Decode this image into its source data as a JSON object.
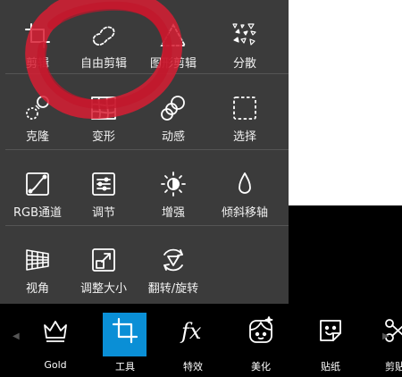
{
  "colors": {
    "panel_bg": "#3b3b3b",
    "accent": "#0a8fd6",
    "scribble": "#d81e34",
    "icon": "#ffffff"
  },
  "tools": [
    [
      {
        "label": "剪辑",
        "icon": "crop-icon",
        "label_color": "#ffffff"
      },
      {
        "label": "自由剪辑",
        "icon": "freeform-cut-icon",
        "label_color": "#ffffff"
      },
      {
        "label": "图形剪辑",
        "icon": "shape-cut-icon",
        "label_color": "#ffffff"
      },
      {
        "label": "分散",
        "icon": "disperse-icon",
        "label_color": "#ffffff"
      }
    ],
    [
      {
        "label": "克隆",
        "icon": "clone-icon"
      },
      {
        "label": "变形",
        "icon": "warp-icon"
      },
      {
        "label": "动感",
        "icon": "motion-icon"
      },
      {
        "label": "选择",
        "icon": "selection-icon"
      }
    ],
    [
      {
        "label": "RGB通道",
        "icon": "rgb-curve-icon"
      },
      {
        "label": "调节",
        "icon": "adjust-icon"
      },
      {
        "label": "增强",
        "icon": "enhance-icon"
      },
      {
        "label": "倾斜移轴",
        "icon": "tilt-shift-icon"
      }
    ],
    [
      {
        "label": "视角",
        "icon": "perspective-icon"
      },
      {
        "label": "调整大小",
        "icon": "resize-icon"
      },
      {
        "label": "翻转/旋转",
        "icon": "flip-rotate-icon"
      }
    ]
  ],
  "bottom_bar": [
    {
      "label": "Gold",
      "icon": "crown-icon",
      "active": false
    },
    {
      "label": "工具",
      "icon": "crop-icon",
      "active": true
    },
    {
      "label": "特效",
      "icon": "fx-icon",
      "active": false
    },
    {
      "label": "美化",
      "icon": "beautify-face-icon",
      "active": false
    },
    {
      "label": "贴纸",
      "icon": "sticker-icon",
      "active": false
    },
    {
      "label": "剪贴",
      "icon": "cutout-icon",
      "active": false
    }
  ]
}
